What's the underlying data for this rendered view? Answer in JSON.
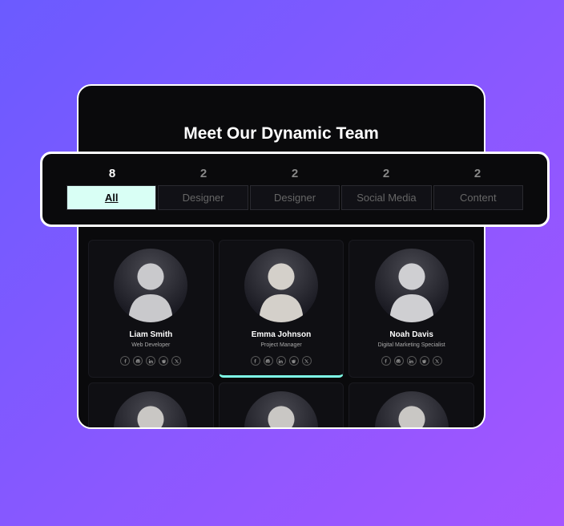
{
  "title": "Meet Our Dynamic Team",
  "filters": [
    {
      "count": "8",
      "label": "All",
      "active": true
    },
    {
      "count": "2",
      "label": "Designer",
      "active": false
    },
    {
      "count": "2",
      "label": "Designer",
      "active": false
    },
    {
      "count": "2",
      "label": "Social Media",
      "active": false
    },
    {
      "count": "2",
      "label": "Content",
      "active": false
    }
  ],
  "members": [
    {
      "name": "Liam Smith",
      "role": "Web Developer",
      "selected": false
    },
    {
      "name": "Emma Johnson",
      "role": "Project Manager",
      "selected": true
    },
    {
      "name": "Noah Davis",
      "role": "Digital Marketing Specialist",
      "selected": false
    }
  ],
  "socials": [
    "facebook-icon",
    "discord-icon",
    "linkedin-icon",
    "reddit-icon",
    "x-icon"
  ]
}
